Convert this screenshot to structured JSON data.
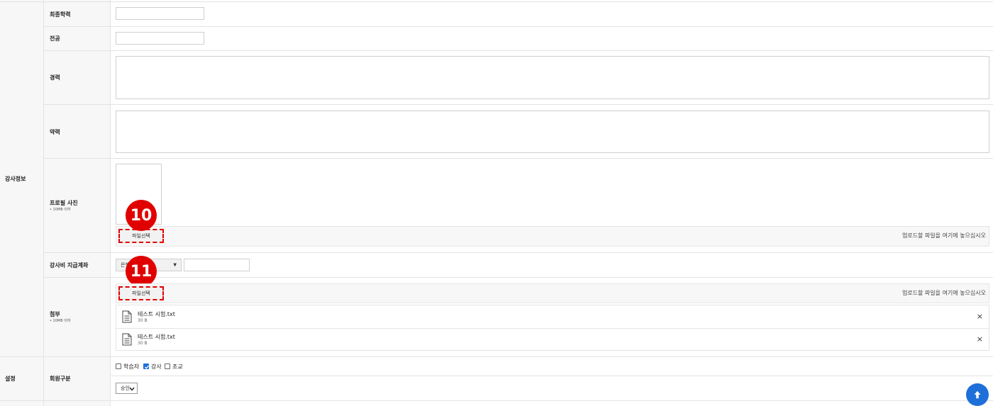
{
  "sections": {
    "instructor_info": "강사정보",
    "settings": "설정"
  },
  "fields": {
    "education": "최종학력",
    "major": "전공",
    "career": "경력",
    "brief": "약력",
    "profile_photo": "프로필 사진",
    "profile_photo_note": "• 10MB 이하",
    "payment_account": "강사비 지급계좌",
    "attachment": "첨부",
    "attachment_note": "• 10MB 이하",
    "member_type": "회원구분"
  },
  "upload": {
    "choose_file": "파일선택",
    "drop_hint": "업로드할 파일을 여기에 놓으십시오"
  },
  "badges": {
    "first": "10",
    "second": "11"
  },
  "bank_select": {
    "selected": "은행"
  },
  "attachments": [
    {
      "name": "테스트 시험.txt",
      "size": "30 B"
    },
    {
      "name": "테스트 시험.txt",
      "size": "30 B"
    }
  ],
  "member_types": [
    {
      "label": "학습자",
      "checked": false
    },
    {
      "label": "강사",
      "checked": true
    },
    {
      "label": "조교",
      "checked": false
    }
  ],
  "approval_select": {
    "selected": "승인"
  },
  "colors": {
    "badge": "#e00000",
    "accent": "#1e6fd9"
  },
  "icons": {
    "remove": "×",
    "file": "file-text-icon",
    "scroll_top": "arrow-up-icon"
  }
}
